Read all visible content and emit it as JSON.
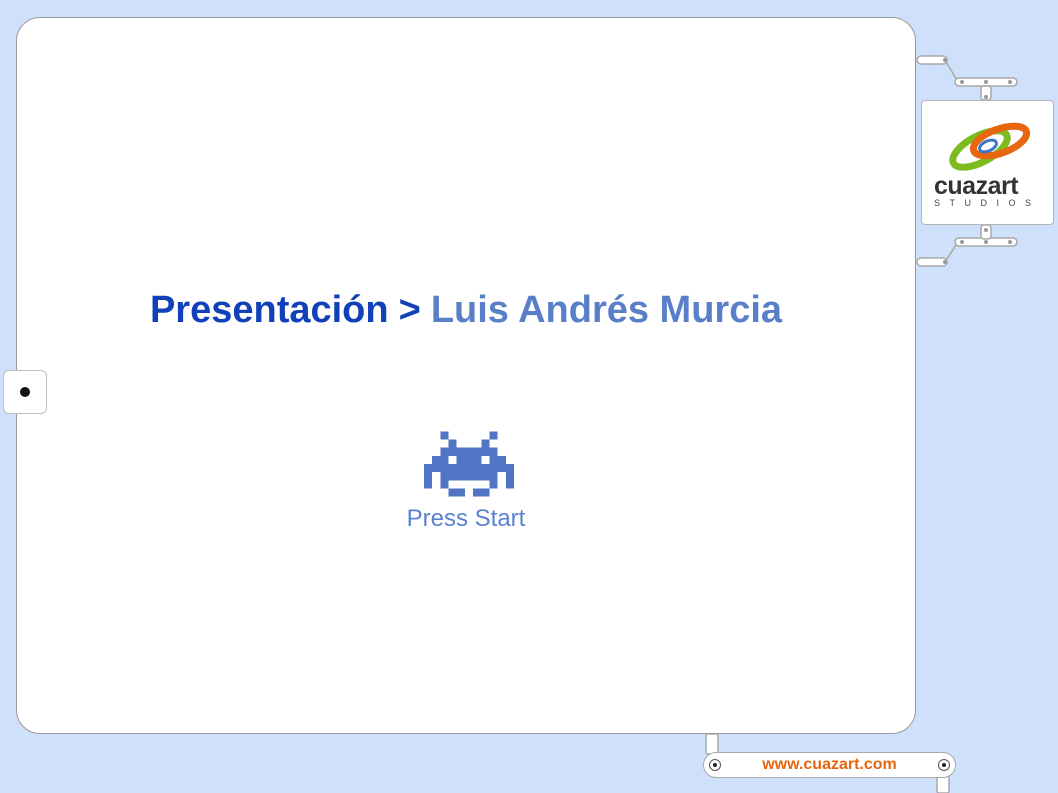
{
  "slide": {
    "title_main": "Presentación",
    "title_separator": ">",
    "title_sub": "Luis Andrés Murcia",
    "press_start": "Press Start"
  },
  "logo": {
    "word": "cuazart",
    "subtitle": "STUDIOS"
  },
  "footer": {
    "url": "www.cuazart.com"
  },
  "colors": {
    "background": "#cfe0fb",
    "title": "#1141b8",
    "subtitle": "#5a7fc9",
    "invader": "#5274c5",
    "press_start": "#5a82d0",
    "logo_green": "#7dbb1e",
    "logo_orange": "#e8660f",
    "logo_blue": "#3c78c8",
    "url": "#e8660f"
  },
  "icons": [
    "space-invader-icon",
    "navigation-dot-icon",
    "cuazart-logo-icon"
  ]
}
